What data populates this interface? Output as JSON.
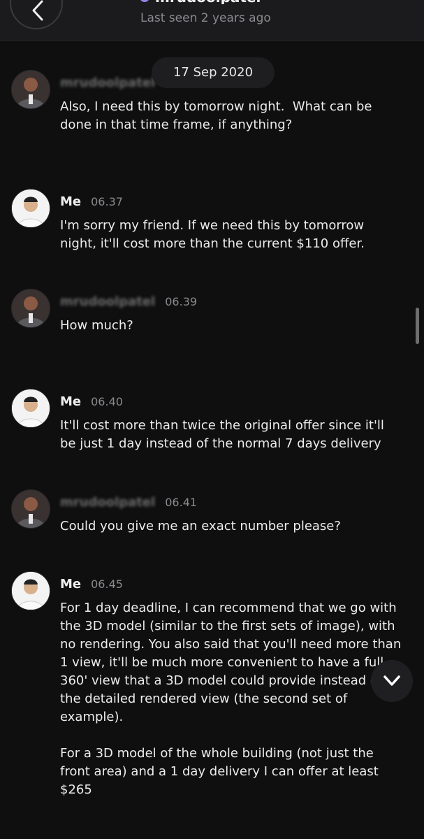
{
  "header": {
    "contact_name": "mrudoolpatel",
    "status": "Last seen 2 years ago",
    "back_icon": "chevron-left-icon",
    "presence_icon": "status-dot-icon"
  },
  "date_separator": "17 Sep 2020",
  "messages": [
    {
      "sender": "mrudoolpatel",
      "time": "",
      "text": "Also, I need this by tomorrow night.  What can be done in that time frame, if anything?"
    },
    {
      "sender": "Me",
      "time": "06.37",
      "text": "I'm sorry my friend. If we need this by tomorrow night, it'll cost more than the current $110 offer."
    },
    {
      "sender": "mrudoolpatel",
      "time": "06.39",
      "text": "How much?"
    },
    {
      "sender": "Me",
      "time": "06.40",
      "text": "It'll cost more than twice the original offer since it'll be just 1 day instead of the normal 7 days delivery"
    },
    {
      "sender": "mrudoolpatel",
      "time": "06.41",
      "text": "Could you give me an exact number please?"
    },
    {
      "sender": "Me",
      "time": "06.45",
      "text": "For 1 day deadline, I can recommend that we go with the 3D model (similar to the first sets of image), with no rendering. You also said that you'll need more than 1 view, it'll be much more convenient to have a full 360' view that a 3D model could provide instead of the detailed rendered view (the second set of example).\n\nFor a 3D model of the whole building (not just the front area) and a 1 day delivery I can offer at least $265"
    }
  ],
  "scroll_down_icon": "chevron-down-icon"
}
